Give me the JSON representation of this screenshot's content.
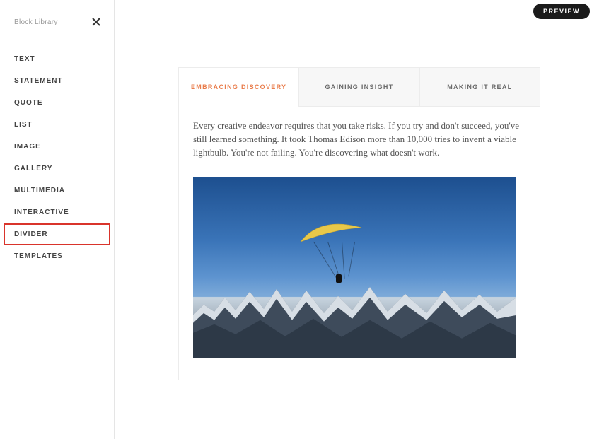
{
  "sidebar": {
    "title": "Block Library",
    "items": [
      {
        "label": "TEXT"
      },
      {
        "label": "STATEMENT"
      },
      {
        "label": "QUOTE"
      },
      {
        "label": "LIST"
      },
      {
        "label": "IMAGE"
      },
      {
        "label": "GALLERY"
      },
      {
        "label": "MULTIMEDIA"
      },
      {
        "label": "INTERACTIVE"
      },
      {
        "label": "DIVIDER",
        "highlighted": true
      },
      {
        "label": "TEMPLATES"
      }
    ]
  },
  "topbar": {
    "preview_label": "PREVIEW"
  },
  "tabs": [
    {
      "label": "EMBRACING DISCOVERY",
      "active": true
    },
    {
      "label": "GAINING INSIGHT"
    },
    {
      "label": "MAKING IT REAL"
    }
  ],
  "body": {
    "text": "Every creative endeavor requires that you take risks. If you try and don't succeed, you've still learned something. It took Thomas Edison more than 10,000 tries to invent a viable lightbulb. You're not failing. You're discovering what doesn't work."
  },
  "image": {
    "alt": "Paraglider over snow-capped mountain range against blue sky"
  }
}
